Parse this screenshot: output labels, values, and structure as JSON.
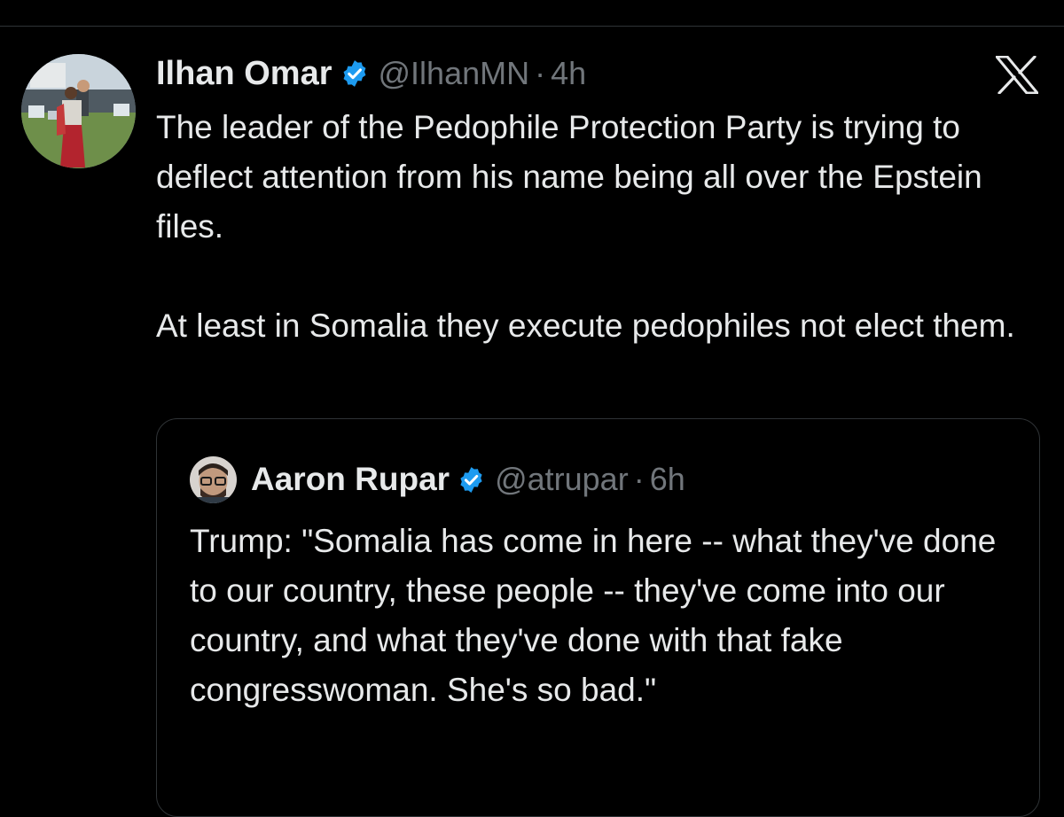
{
  "tweet": {
    "author": {
      "display_name": "Ilhan Omar",
      "handle": "@IlhanMN",
      "separator": "·",
      "time": "4h",
      "verified": true,
      "verified_color": "#1d9bf0"
    },
    "paragraphs": [
      "The leader of the Pedophile Protection Party is trying to deflect attention from his name being all over the Epstein files.",
      "At least in Somalia they execute pedophiles not elect them."
    ],
    "quoted": {
      "author": {
        "display_name": "Aaron Rupar",
        "handle": "@atrupar",
        "separator": "·",
        "time": "6h",
        "verified": true
      },
      "text": "Trump: \"Somalia has come in here -- what they've done to our country, these people -- they've come into our country, and what they've done with that fake congresswoman. She's so bad.\""
    }
  },
  "icons": {
    "brand": "x-logo-icon",
    "verified": "verified-badge-icon"
  },
  "colors": {
    "background": "#000000",
    "text_primary": "#e7e9ea",
    "text_secondary": "#71767b",
    "border": "#2f3336",
    "accent": "#1d9bf0"
  }
}
